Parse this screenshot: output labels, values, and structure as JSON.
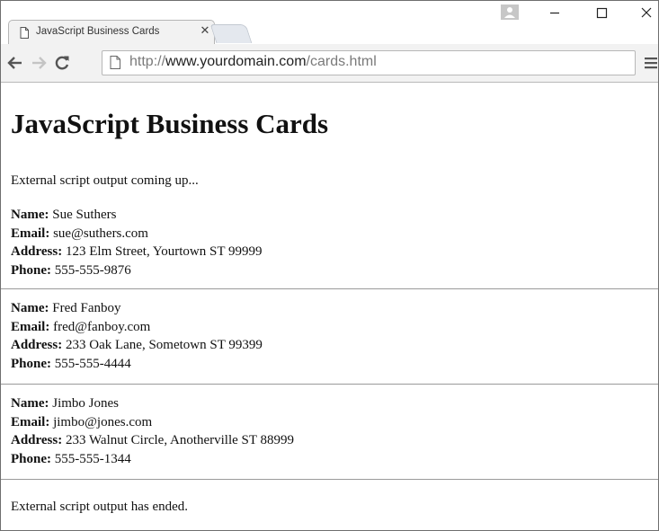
{
  "browser": {
    "tab": {
      "title": "JavaScript Business Cards",
      "close_icon": "close-icon"
    },
    "url": {
      "scheme": "http://",
      "host": "www.yourdomain.com",
      "path": "/cards.html"
    },
    "icons": {
      "back": "back-arrow-icon",
      "forward": "forward-arrow-icon",
      "reload": "reload-icon",
      "page": "page-icon",
      "menu": "hamburger-menu-icon",
      "profile": "profile-icon",
      "minimize": "minimize-icon",
      "maximize": "maximize-icon",
      "close": "close-icon"
    }
  },
  "page": {
    "title": "JavaScript Business Cards",
    "intro": "External script output coming up...",
    "outro": "External script output has ended.",
    "labels": {
      "name": "Name:",
      "email": "Email:",
      "address": "Address:",
      "phone": "Phone:"
    },
    "cards": [
      {
        "name": "Sue Suthers",
        "email": "sue@suthers.com",
        "address": "123 Elm Street, Yourtown ST 99999",
        "phone": "555-555-9876"
      },
      {
        "name": "Fred Fanboy",
        "email": "fred@fanboy.com",
        "address": "233 Oak Lane, Sometown ST 99399",
        "phone": "555-555-4444"
      },
      {
        "name": "Jimbo Jones",
        "email": "jimbo@jones.com",
        "address": "233 Walnut Circle, Anotherville ST 88999",
        "phone": "555-555-1344"
      }
    ]
  }
}
